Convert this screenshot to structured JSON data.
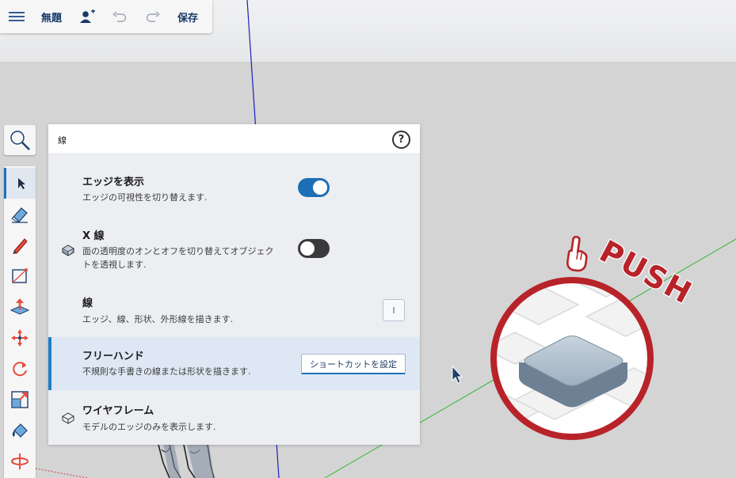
{
  "toolbar": {
    "document_title": "無題",
    "save_label": "保存",
    "icons": [
      "hamburger-menu-icon",
      "add-user-icon",
      "undo-icon",
      "redo-icon"
    ]
  },
  "tools": {
    "search_icon": "magnifier-icon",
    "items": [
      "select-arrow-icon",
      "eraser-icon",
      "pencil-icon",
      "rectangle-icon",
      "push-pull-icon",
      "move-icon",
      "rotate-icon",
      "scale-icon",
      "paint-bucket-icon",
      "orbit-icon"
    ]
  },
  "panel": {
    "title": "線",
    "help_label": "?",
    "rows": [
      {
        "title": "エッジを表示",
        "description": "エッジの可視性を切り替えます.",
        "toggle": "on"
      },
      {
        "title": "X 線",
        "description_line1": "面の透明度のオンとオフを切り替えてオブジェク",
        "description_line2": "トを透視します.",
        "toggle": "off"
      },
      {
        "title": "線",
        "description": "エッジ、線、形状、外形線を描きます.",
        "shortcut_key": "l"
      },
      {
        "title": "フリーハンド",
        "description": "不規則な手書きの線または形状を描きます.",
        "shortcut_button": "ショートカットを設定"
      },
      {
        "title": "ワイヤフレーム",
        "description": "モデルのエッジのみを表示します."
      }
    ]
  },
  "overlay": {
    "push_text": "PUSH"
  },
  "colors": {
    "accent": "#1c6fb5",
    "toolbar_text": "#173a66",
    "push_red": "#b8232a",
    "green_axis": "#2fb82f",
    "blue_axis": "#1d1dbf"
  }
}
